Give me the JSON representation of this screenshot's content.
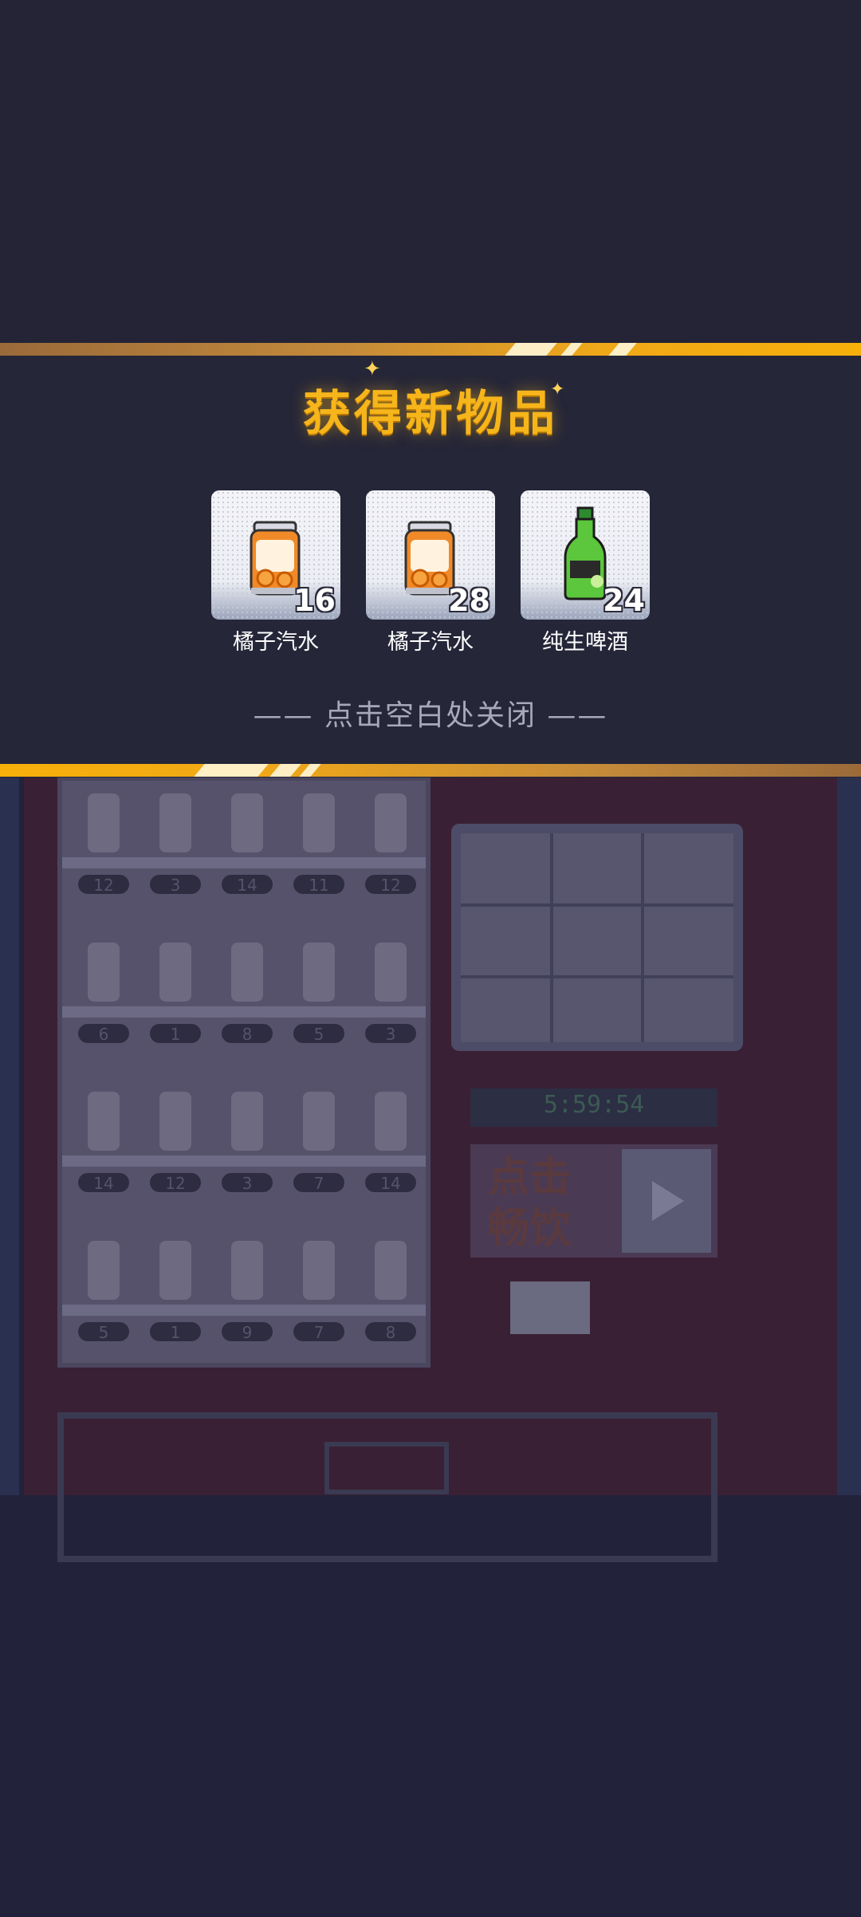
{
  "popup": {
    "title": "获得新物品",
    "hint": "—— 点击空白处关闭 ——",
    "items": [
      {
        "name": "橘子汽水",
        "count": "16",
        "icon": "orange-soda-can-icon"
      },
      {
        "name": "橘子汽水",
        "count": "28",
        "icon": "orange-soda-can-icon"
      },
      {
        "name": "纯生啤酒",
        "count": "24",
        "icon": "green-beer-bottle-icon"
      }
    ]
  },
  "background": {
    "shelf_counts": [
      [
        "12",
        "3",
        "14",
        "11",
        "12"
      ],
      [
        "6",
        "1",
        "8",
        "5",
        "3"
      ],
      [
        "14",
        "12",
        "3",
        "7",
        "14"
      ],
      [
        "5",
        "1",
        "9",
        "7",
        "8"
      ]
    ],
    "timer": "5:59:54",
    "ad_button_label": "点击畅饮",
    "play_icon": "play-icon"
  },
  "colors": {
    "accent": "#f6b51a",
    "panel": "#252638",
    "machine_red": "#3a2030"
  }
}
